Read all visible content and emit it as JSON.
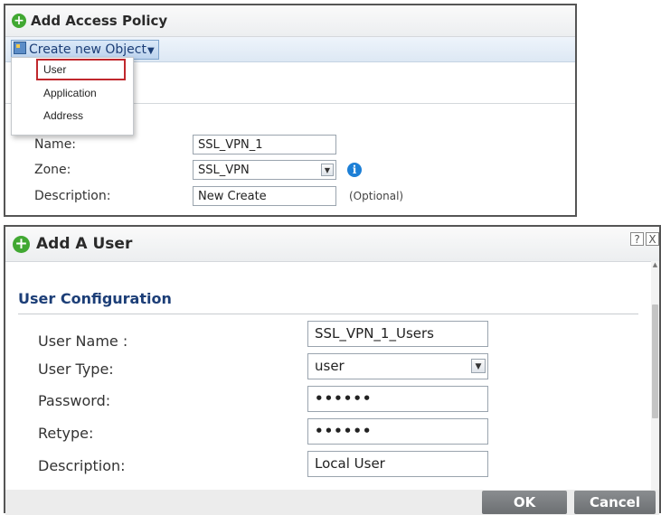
{
  "access_policy": {
    "title": "Add Access Policy",
    "create_button": "Create new Object",
    "menu": {
      "items": [
        "User",
        "Application",
        "Address"
      ],
      "highlighted": "User"
    },
    "partial_label": "y",
    "fields": {
      "name": {
        "label": "Name:",
        "value": "SSL_VPN_1"
      },
      "zone": {
        "label": "Zone:",
        "value": "SSL_VPN"
      },
      "description": {
        "label": "Description:",
        "value": "New Create",
        "hint": "(Optional)"
      }
    }
  },
  "add_user": {
    "title": "Add A User",
    "window_buttons": {
      "help": "?",
      "close": "X"
    },
    "section_title": "User Configuration",
    "fields": {
      "user_name": {
        "label": "User Name :",
        "value": "SSL_VPN_1_Users"
      },
      "user_type": {
        "label": "User Type:",
        "value": "user"
      },
      "password": {
        "label": "Password:",
        "value": "••••••"
      },
      "retype": {
        "label": "Retype:",
        "value": "••••••"
      },
      "description": {
        "label": "Description:",
        "value": "Local User"
      }
    },
    "buttons": {
      "ok": "OK",
      "cancel": "Cancel"
    }
  },
  "colors": {
    "accent_green": "#41a832",
    "title_blue": "#1c3e77",
    "highlight_red": "#c0282d",
    "button_gray": "#7b7e81",
    "info_blue": "#1c7fd6"
  },
  "icons": [
    "add-icon",
    "object-icon",
    "info-icon",
    "help-icon",
    "close-icon",
    "dropdown-arrow-icon"
  ]
}
